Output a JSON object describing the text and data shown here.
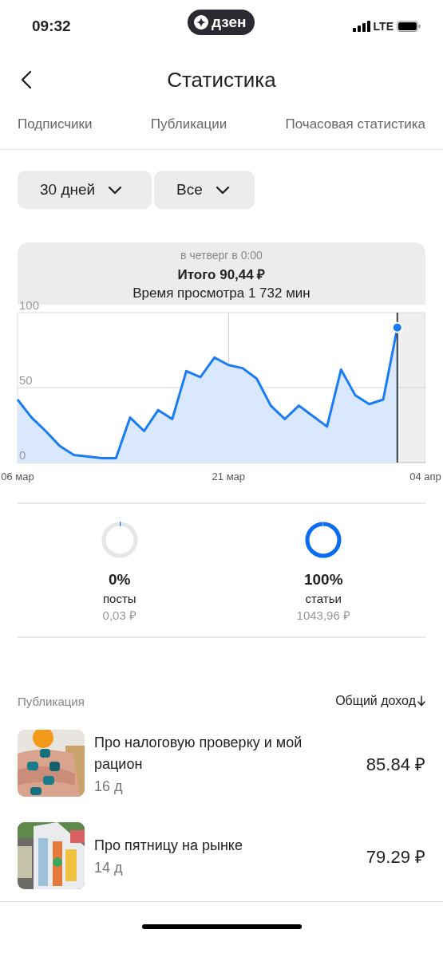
{
  "status_bar": {
    "time": "09:32",
    "badge": "дзен",
    "network": "LTE"
  },
  "header": {
    "title": "Статистика"
  },
  "tabs": [
    {
      "label": "Подписчики",
      "selected": false
    },
    {
      "label": "Публикации",
      "selected": false
    },
    {
      "label": "Почасовая статистика",
      "selected": false
    }
  ],
  "filters": [
    {
      "label": "30 дней"
    },
    {
      "label": "Все"
    }
  ],
  "tooltip": {
    "subtitle": "в четверг в 0:00",
    "total": "Итого 90,44 ₽",
    "watch_time": "Время просмотра 1 732 мин"
  },
  "chart_data": {
    "type": "area",
    "categories": [
      "06 мар",
      null,
      null,
      null,
      null,
      null,
      null,
      null,
      null,
      null,
      null,
      null,
      null,
      null,
      null,
      "21 мар",
      null,
      null,
      null,
      null,
      null,
      null,
      null,
      null,
      null,
      null,
      null,
      null,
      null,
      "04 апр"
    ],
    "ylim": [
      0,
      100
    ],
    "yticks": [
      0,
      50,
      100
    ],
    "ref_lines": [
      {
        "axis": "y",
        "value": 50
      }
    ],
    "series": [
      {
        "color": "#1a7cf5",
        "values": [
          42,
          30,
          21,
          11,
          5,
          4,
          3,
          3,
          30,
          21,
          35,
          29,
          61,
          57,
          70,
          65,
          63,
          56,
          38,
          29,
          38,
          31,
          24,
          62,
          45,
          39,
          42,
          90,
          null,
          null
        ]
      }
    ]
  },
  "breakdown": [
    {
      "percent": "0%",
      "label": "посты",
      "amount": "0,03 ₽",
      "level": 0.01
    },
    {
      "percent": "100%",
      "label": "статьи",
      "amount": "1043,96 ₽",
      "level": 0.99
    }
  ],
  "table": {
    "columns": [
      "Публикация",
      "Общий доход"
    ],
    "rows": [
      {
        "title": "Про налоговую проверку и мой рацион",
        "age": "16 д",
        "revenue": "85.84 ₽",
        "kind": "picture"
      },
      {
        "title": "Про пятницу на рынке",
        "age": "14 д",
        "revenue": "79.29 ₽",
        "kind": "picture"
      }
    ]
  }
}
